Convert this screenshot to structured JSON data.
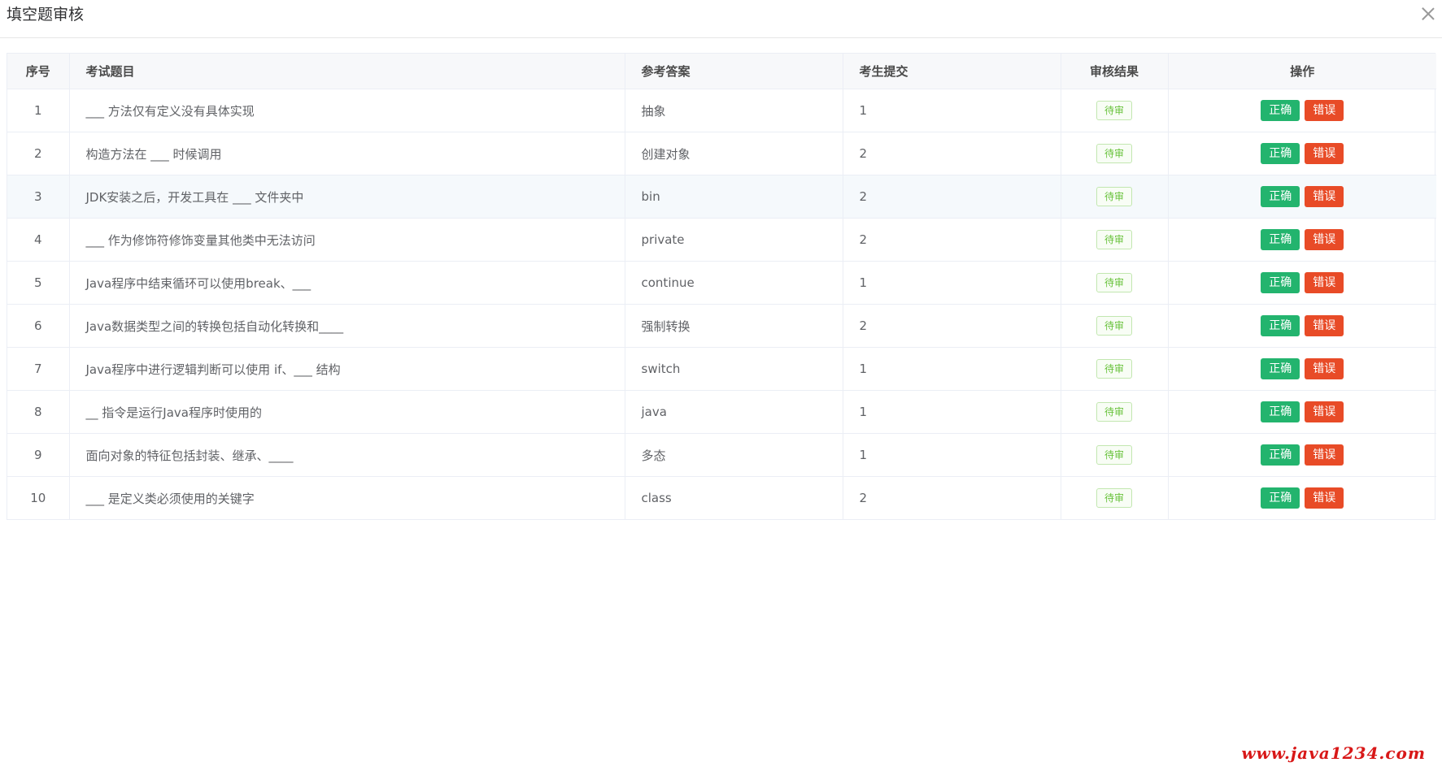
{
  "dialog": {
    "title": "填空题审核",
    "close_icon": "close-icon"
  },
  "table": {
    "headers": [
      "序号",
      "考试题目",
      "参考答案",
      "考生提交",
      "审核结果",
      "操作"
    ],
    "rows": [
      {
        "index": "1",
        "question": "___ 方法仅有定义没有具体实现",
        "answer": "抽象",
        "submission": "1",
        "status": "待审",
        "ok_label": "正确",
        "err_label": "错误"
      },
      {
        "index": "2",
        "question": "构造方法在 ___ 时候调用",
        "answer": "创建对象",
        "submission": "2",
        "status": "待审",
        "ok_label": "正确",
        "err_label": "错误"
      },
      {
        "index": "3",
        "question": "JDK安装之后，开发工具在 ___ 文件夹中",
        "answer": "bin",
        "submission": "2",
        "status": "待审",
        "ok_label": "正确",
        "err_label": "错误"
      },
      {
        "index": "4",
        "question": "___ 作为修饰符修饰变量其他类中无法访问",
        "answer": "private",
        "submission": "2",
        "status": "待审",
        "ok_label": "正确",
        "err_label": "错误"
      },
      {
        "index": "5",
        "question": "Java程序中结束循环可以使用break、___",
        "answer": "continue",
        "submission": "1",
        "status": "待审",
        "ok_label": "正确",
        "err_label": "错误"
      },
      {
        "index": "6",
        "question": "Java数据类型之间的转换包括自动化转换和____",
        "answer": "强制转换",
        "submission": "2",
        "status": "待审",
        "ok_label": "正确",
        "err_label": "错误"
      },
      {
        "index": "7",
        "question": "Java程序中进行逻辑判断可以使用 if、___ 结构",
        "answer": "switch",
        "submission": "1",
        "status": "待审",
        "ok_label": "正确",
        "err_label": "错误"
      },
      {
        "index": "8",
        "question": "__ 指令是运行Java程序时使用的",
        "answer": "java",
        "submission": "1",
        "status": "待审",
        "ok_label": "正确",
        "err_label": "错误"
      },
      {
        "index": "9",
        "question": "面向对象的特征包括封装、继承、____",
        "answer": "多态",
        "submission": "1",
        "status": "待审",
        "ok_label": "正确",
        "err_label": "错误"
      },
      {
        "index": "10",
        "question": "___ 是定义类必须使用的关键字",
        "answer": "class",
        "submission": "2",
        "status": "待审",
        "ok_label": "正确",
        "err_label": "错误"
      }
    ]
  },
  "watermark": "www.java1234.com",
  "colors": {
    "correct_button": "#23b46e",
    "wrong_button": "#e84b27",
    "pending_badge": "#67c23a"
  }
}
